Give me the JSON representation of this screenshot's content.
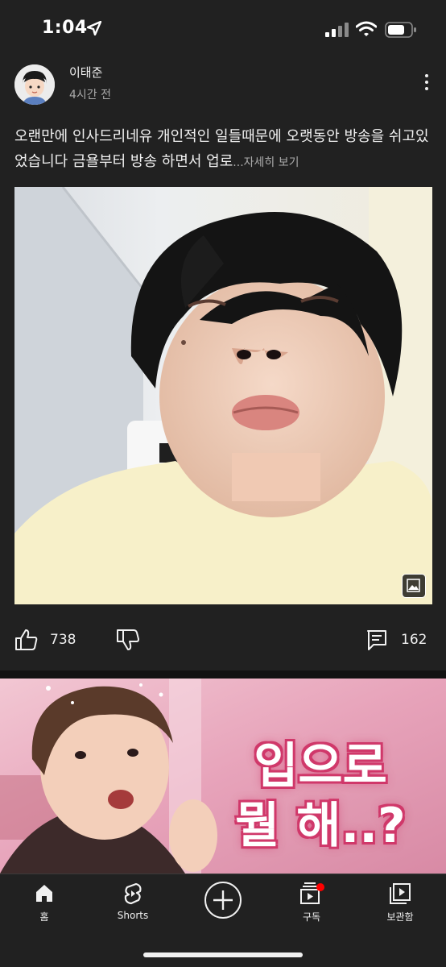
{
  "status_bar": {
    "time": "1:04"
  },
  "post": {
    "author": "이태준",
    "time_ago": "4시간 전",
    "text": "오랜만에 인사드리네유 개인적인 일들때문에 오랫동안 방송을 쉬고있었습니다 금욜부터 방송 하면서 업로",
    "more_label": "...자세히 보기",
    "likes": "738",
    "comments": "162"
  },
  "video_thumbnail": {
    "title_line1": "입으로",
    "title_line2": "뭘 해..?"
  },
  "bottom_nav": {
    "items": [
      {
        "label": "홈",
        "icon": "home-icon"
      },
      {
        "label": "Shorts",
        "icon": "shorts-icon"
      },
      {
        "label": "",
        "icon": "create-icon"
      },
      {
        "label": "구독",
        "icon": "subscriptions-icon"
      },
      {
        "label": "보관함",
        "icon": "library-icon"
      }
    ]
  },
  "colors": {
    "background": "#212121",
    "accent_red": "#ff0000",
    "secondary_text": "#aaaaaa"
  }
}
